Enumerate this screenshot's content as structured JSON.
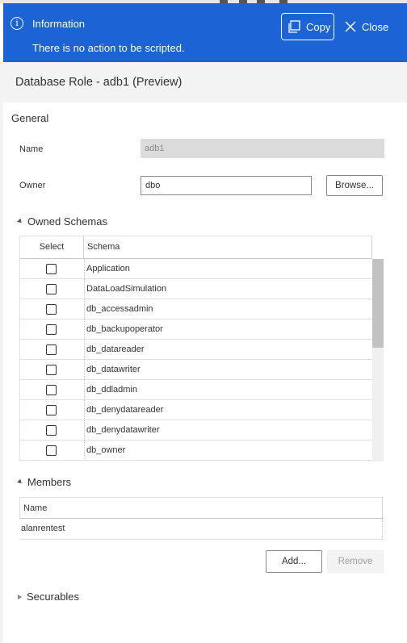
{
  "info_bar": {
    "title": "Information",
    "message": "There is no action to be scripted.",
    "copy_label": "Copy",
    "close_label": "Close",
    "icon": "info-icon",
    "color": "#1c63d5"
  },
  "dialog": {
    "title": "Database Role - adb1 (Preview)"
  },
  "general": {
    "section_label": "General",
    "name_label": "Name",
    "name_value": "adb1",
    "owner_label": "Owner",
    "owner_value": "dbo",
    "browse_label": "Browse..."
  },
  "owned_schemas": {
    "section_label": "Owned Schemas",
    "columns": [
      "Select",
      "Schema"
    ],
    "rows": [
      {
        "schema": "Application",
        "selected": false
      },
      {
        "schema": "DataLoadSimulation",
        "selected": false
      },
      {
        "schema": "db_accessadmin",
        "selected": false
      },
      {
        "schema": "db_backupoperator",
        "selected": false
      },
      {
        "schema": "db_datareader",
        "selected": false
      },
      {
        "schema": "db_datawriter",
        "selected": false
      },
      {
        "schema": "db_ddladmin",
        "selected": false
      },
      {
        "schema": "db_denydatareader",
        "selected": false
      },
      {
        "schema": "db_denydatawriter",
        "selected": false
      },
      {
        "schema": "db_owner",
        "selected": false
      }
    ]
  },
  "members": {
    "section_label": "Members",
    "columns": [
      "Name"
    ],
    "rows": [
      {
        "name": "alanrentest"
      }
    ],
    "add_label": "Add...",
    "remove_label": "Remove"
  },
  "securables": {
    "section_label": "Securables"
  }
}
